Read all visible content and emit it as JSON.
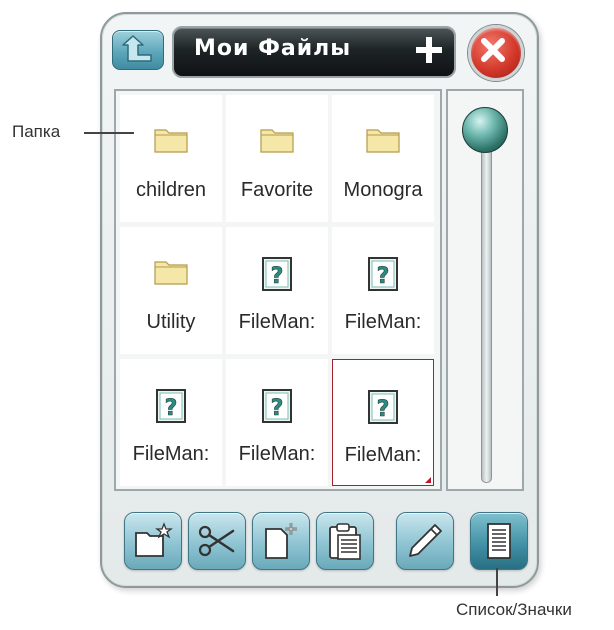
{
  "header": {
    "title": "Мои Файлы",
    "icons": [
      "up-folder-icon",
      "plus-icon",
      "close-icon"
    ]
  },
  "files": [
    {
      "label": "children",
      "icon": "folder-icon"
    },
    {
      "label": "Favorite",
      "icon": "folder-icon"
    },
    {
      "label": "Monogra",
      "icon": "folder-icon"
    },
    {
      "label": "Utility",
      "icon": "folder-icon"
    },
    {
      "label": "FileMan:",
      "icon": "unknown-file-icon"
    },
    {
      "label": "FileMan:",
      "icon": "unknown-file-icon"
    },
    {
      "label": "FileMan:",
      "icon": "unknown-file-icon"
    },
    {
      "label": "FileMan:",
      "icon": "unknown-file-icon"
    },
    {
      "label": "FileMan:",
      "icon": "unknown-file-icon",
      "selected": true
    }
  ],
  "toolbar": {
    "buttons": [
      "new-folder-icon",
      "scissors-icon",
      "new-file-icon",
      "paste-icon",
      "pencil-icon",
      "list-view-icon"
    ]
  },
  "callouts": {
    "folder": "Папка",
    "list_icons": "Список/Значки"
  },
  "colors": {
    "accent": "#5ea7bb",
    "title_bar": "#1e2426",
    "close": "#d3392b",
    "selection": "#a6212e",
    "folder": "#f5e7a8"
  }
}
